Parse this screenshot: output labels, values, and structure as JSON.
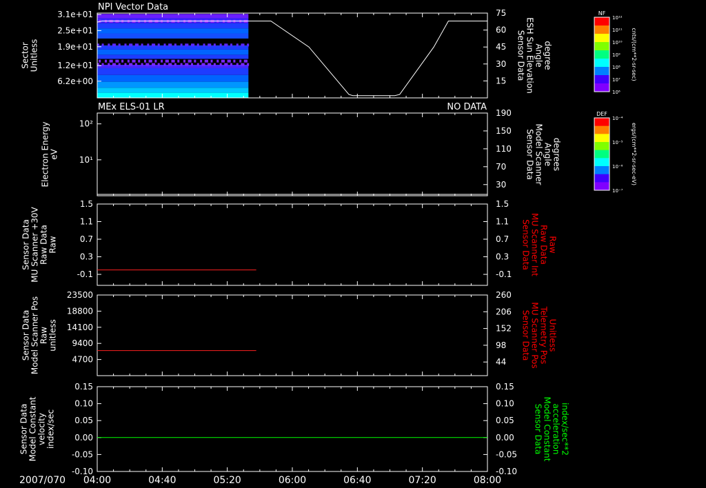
{
  "date_label": "2007/070",
  "time_ticks": [
    "04:00",
    "04:40",
    "05:20",
    "06:00",
    "06:40",
    "07:20",
    "08:00"
  ],
  "colorbars": [
    {
      "label": "NF",
      "units": "cnts/(cm**2-sr-sec)",
      "tick_labels": [
        "10¹²",
        "10¹¹",
        "10¹⁰",
        "10⁹",
        "10⁸",
        "10⁷",
        "10⁶"
      ]
    },
    {
      "label": "DEF",
      "units": "ergs/(cm**2-sr-sec-eV)",
      "tick_labels": [
        "10⁻⁴",
        "10⁻⁵",
        "10⁻⁶",
        "10⁻⁷"
      ]
    }
  ],
  "chart_data": [
    {
      "type": "heatmap",
      "title": "NPI Vector Data",
      "left_axis": {
        "label_lines": [
          "Sector",
          "Unitless"
        ],
        "ticks": [
          6.2,
          12,
          19,
          25,
          31
        ],
        "tick_labels": [
          "6.2e+00",
          "1.2e+01",
          "1.9e+01",
          "2.5e+01",
          "3.1e+01"
        ],
        "range": [
          0,
          31.5
        ]
      },
      "right_axis": {
        "label_lines": [
          "Sensor Data",
          "ESH Sun Elevation",
          "Angle",
          "degree"
        ],
        "ticks": [
          15,
          30,
          45,
          60,
          75
        ],
        "range": [
          0,
          75
        ]
      },
      "data_extent_hours": [
        4.0,
        5.55
      ],
      "line_series": {
        "name": "ESH Sun Elevation",
        "x_hours": [
          4.0,
          4.05,
          5.78,
          6.17,
          6.58,
          6.62,
          7.05,
          7.1,
          7.45,
          7.6,
          8.0
        ],
        "y": [
          67,
          68,
          68,
          45,
          3,
          2,
          2,
          3,
          45,
          68,
          68
        ]
      },
      "colorbar": "NF"
    },
    {
      "type": "line",
      "title": "MEx ELS-01 LR",
      "status": "NO DATA",
      "left_axis": {
        "label_lines": [
          "Electron Energy",
          "eV"
        ],
        "scale": "log",
        "ticks": [
          10,
          100
        ],
        "tick_labels": [
          "10¹",
          "10²"
        ],
        "range": [
          1,
          200
        ]
      },
      "right_axis": {
        "label_lines": [
          "Sensor Data",
          "Model Scanner",
          "Angle",
          "degrees"
        ],
        "ticks": [
          30,
          70,
          110,
          150,
          190
        ],
        "range": [
          5,
          190
        ]
      },
      "series": [
        {
          "name": "Model Scanner Angle",
          "color": "#ffffff",
          "x_hours": [
            4.0,
            8.0
          ],
          "y": [
            8,
            8
          ]
        }
      ],
      "colorbar": "DEF"
    },
    {
      "type": "line",
      "left_axis": {
        "label_lines": [
          "Sensor Data",
          "MU Scanner +30V",
          "Raw Data",
          "Raw"
        ],
        "ticks": [
          -0.1,
          0.3,
          0.7,
          1.1,
          1.5
        ],
        "tick_labels": [
          "-0.1",
          "0.3",
          "0.7",
          "1.1",
          "1.5"
        ],
        "range": [
          -0.35,
          1.5
        ]
      },
      "right_axis": {
        "label_lines": [
          "Sensor Data",
          "MU Scanner Int",
          "Raw Data",
          "Raw"
        ],
        "label_color": "#ff0000",
        "ticks": [
          -0.1,
          0.3,
          0.7,
          1.1,
          1.5
        ],
        "tick_labels": [
          "-0.1",
          "0.3",
          "0.7",
          "1.1",
          "1.5"
        ],
        "range": [
          -0.35,
          1.5
        ]
      },
      "series": [
        {
          "name": "MU Scanner +30V",
          "color": "#ff2020",
          "x_hours": [
            4.0,
            5.63
          ],
          "y": [
            0.0,
            0.0
          ]
        }
      ]
    },
    {
      "type": "line",
      "left_axis": {
        "label_lines": [
          "Sensor Data",
          "Model Scanner Pos",
          "Raw",
          "unitless"
        ],
        "ticks": [
          4700,
          9400,
          14100,
          18800,
          23500
        ],
        "tick_labels": [
          "4700",
          "9400",
          "14100",
          "18800",
          "23500"
        ],
        "range": [
          0,
          23500
        ]
      },
      "right_axis": {
        "label_lines": [
          "Sensor Data",
          "MU Scanner Pos",
          "Telemetry Pos",
          "Unitless"
        ],
        "label_color": "#ff0000",
        "ticks": [
          44,
          98,
          152,
          206,
          260
        ],
        "tick_labels": [
          "44",
          "98",
          "152",
          "206",
          "260"
        ],
        "range": [
          0,
          260
        ]
      },
      "series": [
        {
          "name": "Model Scanner Pos",
          "color": "#ff2020",
          "x_hours": [
            4.0,
            5.63
          ],
          "y": [
            7300,
            7300
          ]
        }
      ]
    },
    {
      "type": "line",
      "left_axis": {
        "label_lines": [
          "Sensor Data",
          "Model Constant",
          "velocity",
          "index/sec"
        ],
        "ticks": [
          -0.1,
          -0.05,
          0.0,
          0.05,
          0.1,
          0.15
        ],
        "tick_labels": [
          "-0.10",
          "-0.05",
          "0.00",
          "0.05",
          "0.10",
          "0.15"
        ],
        "range": [
          -0.1,
          0.15
        ]
      },
      "right_axis": {
        "label_lines": [
          "Sensor Data",
          "Model Constant",
          "acceleration",
          "index/sec**2"
        ],
        "label_color": "#00ff00",
        "ticks": [
          -0.1,
          -0.05,
          0.0,
          0.05,
          0.1,
          0.15
        ],
        "tick_labels": [
          "-0.10",
          "-0.05",
          "0.00",
          "0.05",
          "0.10",
          "0.15"
        ],
        "range": [
          -0.1,
          0.15
        ]
      },
      "series": [
        {
          "name": "Model Constant velocity",
          "color": "#00ff00",
          "x_hours": [
            4.0,
            8.0
          ],
          "y": [
            0.0,
            0.0
          ]
        }
      ]
    }
  ]
}
